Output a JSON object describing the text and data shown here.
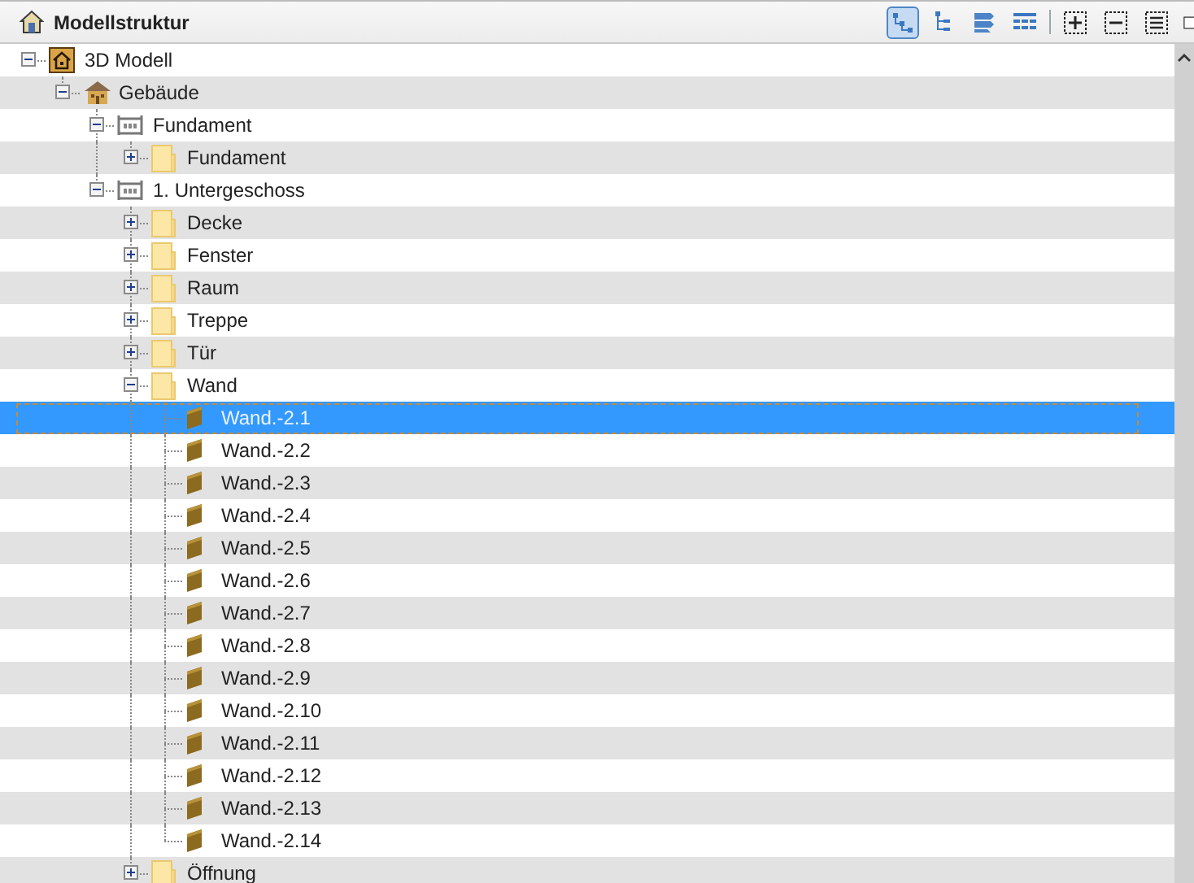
{
  "panel": {
    "title": "Modellstruktur"
  },
  "toolbar": [
    {
      "kind": "tree",
      "selected": true
    },
    {
      "kind": "outline",
      "selected": false
    },
    {
      "kind": "stack",
      "selected": false
    },
    {
      "kind": "grid",
      "selected": false
    },
    {
      "kind": "separator"
    },
    {
      "kind": "expand",
      "selected": false
    },
    {
      "kind": "collapse",
      "selected": false
    },
    {
      "kind": "list",
      "selected": false
    },
    {
      "kind": "window",
      "selected": false
    }
  ],
  "tree": [
    {
      "label": "3D Modell",
      "kind": "model",
      "expanded": true,
      "selected": false,
      "children": [
        {
          "label": "Gebäude",
          "kind": "building",
          "expanded": true,
          "selected": false,
          "children": [
            {
              "label": "Fundament",
              "kind": "floor",
              "expanded": true,
              "selected": false,
              "children": [
                {
                  "label": "Fundament",
                  "kind": "folder",
                  "expanded": false,
                  "selected": false
                }
              ]
            },
            {
              "label": "1. Untergeschoss",
              "kind": "floor",
              "expanded": true,
              "selected": false,
              "children": [
                {
                  "label": "Decke",
                  "kind": "folder",
                  "expanded": false,
                  "selected": false
                },
                {
                  "label": "Fenster",
                  "kind": "folder",
                  "expanded": false,
                  "selected": false
                },
                {
                  "label": "Raum",
                  "kind": "folder",
                  "expanded": false,
                  "selected": false
                },
                {
                  "label": "Treppe",
                  "kind": "folder",
                  "expanded": false,
                  "selected": false
                },
                {
                  "label": "Tür",
                  "kind": "folder",
                  "expanded": false,
                  "selected": false
                },
                {
                  "label": "Wand",
                  "kind": "folder",
                  "expanded": true,
                  "selected": false,
                  "children": [
                    {
                      "label": "Wand.-2.1",
                      "kind": "wall",
                      "selected": true
                    },
                    {
                      "label": "Wand.-2.2",
                      "kind": "wall",
                      "selected": false
                    },
                    {
                      "label": "Wand.-2.3",
                      "kind": "wall",
                      "selected": false
                    },
                    {
                      "label": "Wand.-2.4",
                      "kind": "wall",
                      "selected": false
                    },
                    {
                      "label": "Wand.-2.5",
                      "kind": "wall",
                      "selected": false
                    },
                    {
                      "label": "Wand.-2.6",
                      "kind": "wall",
                      "selected": false
                    },
                    {
                      "label": "Wand.-2.7",
                      "kind": "wall",
                      "selected": false
                    },
                    {
                      "label": "Wand.-2.8",
                      "kind": "wall",
                      "selected": false
                    },
                    {
                      "label": "Wand.-2.9",
                      "kind": "wall",
                      "selected": false
                    },
                    {
                      "label": "Wand.-2.10",
                      "kind": "wall",
                      "selected": false
                    },
                    {
                      "label": "Wand.-2.11",
                      "kind": "wall",
                      "selected": false
                    },
                    {
                      "label": "Wand.-2.12",
                      "kind": "wall",
                      "selected": false
                    },
                    {
                      "label": "Wand.-2.13",
                      "kind": "wall",
                      "selected": false
                    },
                    {
                      "label": "Wand.-2.14",
                      "kind": "wall",
                      "selected": false
                    }
                  ]
                },
                {
                  "label": "Öffnung",
                  "kind": "folder",
                  "expanded": false,
                  "selected": false
                }
              ]
            }
          ]
        }
      ]
    }
  ]
}
